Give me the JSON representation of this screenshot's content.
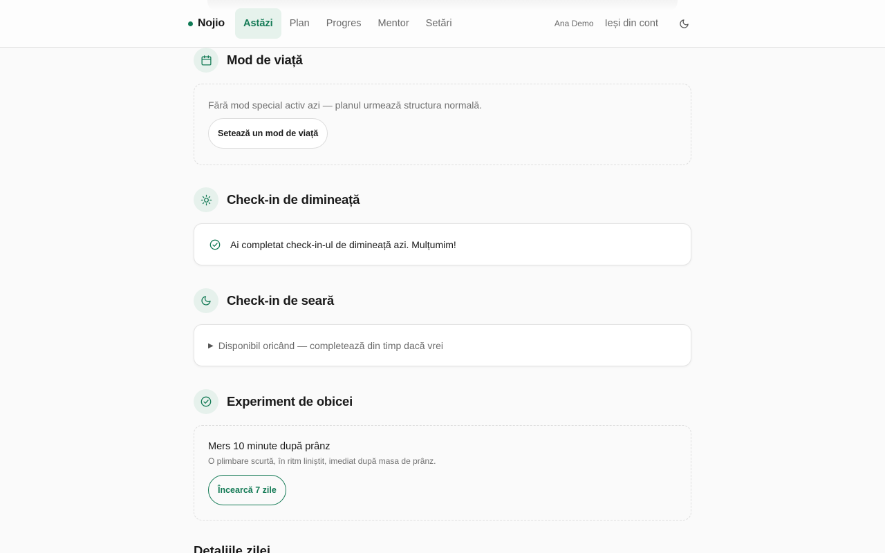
{
  "nav": {
    "brand": "Nojio",
    "items": [
      {
        "label": "Astăzi",
        "active": true
      },
      {
        "label": "Plan",
        "active": false
      },
      {
        "label": "Progres",
        "active": false
      },
      {
        "label": "Mentor",
        "active": false
      },
      {
        "label": "Setări",
        "active": false
      }
    ],
    "user_name": "Ana Demo",
    "logout_label": "Ieși din cont",
    "theme_icon": "moon-icon"
  },
  "sections": {
    "lifestyle": {
      "icon": "calendar-icon",
      "title": "Mod de viață",
      "message": "Fără mod special activ azi — planul urmează structura normală.",
      "button_label": "Setează un mod de viață"
    },
    "morning": {
      "icon": "sun-icon",
      "title": "Check-in de dimineață",
      "status_icon": "check-circle-icon",
      "message": "Ai completat check-in-ul de dimineață azi. Mulțumim!"
    },
    "evening": {
      "icon": "moon-icon",
      "title": "Check-in de seară",
      "summary": "Disponibil oricând — completează din timp dacă vrei"
    },
    "experiment": {
      "icon": "check-circle-icon",
      "title": "Experiment de obicei",
      "habit_title": "Mers 10 minute după prânz",
      "habit_description": "O plimbare scurtă, în ritm liniștit, imediat după masa de prânz.",
      "button_label": "Încearcă 7 zile"
    },
    "day_details": {
      "title": "Detaliile zilei"
    }
  },
  "colors": {
    "accent": "#137a55",
    "accent_soft": "#e6f2ec",
    "background": "#fafafa"
  }
}
